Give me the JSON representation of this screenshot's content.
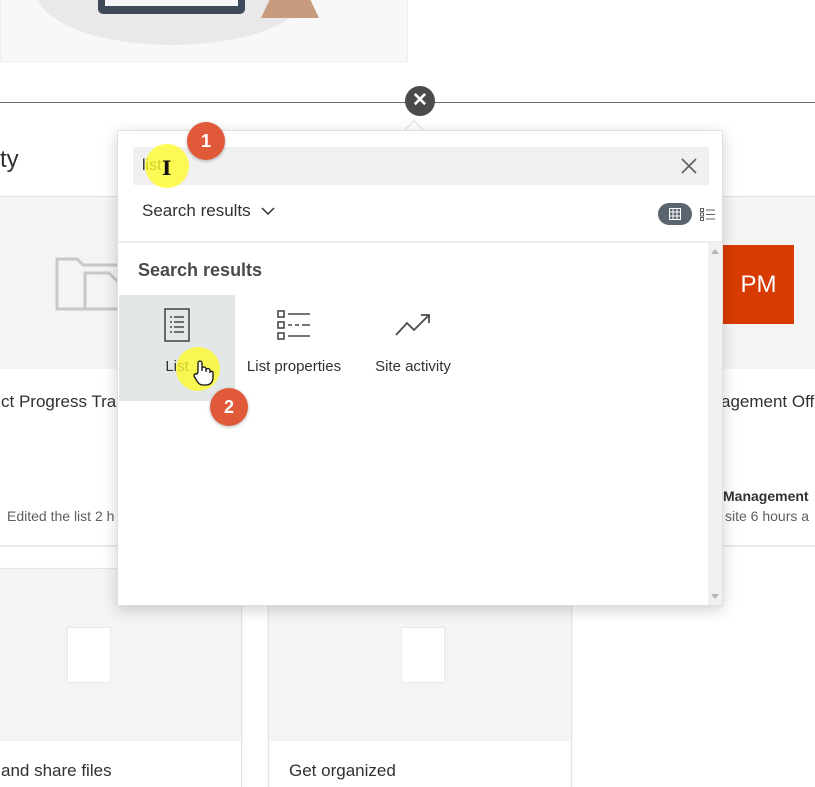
{
  "background": {
    "section_heading": "ty",
    "cards": {
      "progress_tracker": {
        "title": "ct Progress Trac",
        "meta": "Edited the list 2 h"
      },
      "pmo": {
        "tile_initials": "PM",
        "title": "agement Off",
        "bold_line": "Management",
        "meta": "site 6 hours a"
      },
      "share_files": {
        "title": "and share files"
      },
      "get_organized": {
        "title": "Get organized"
      }
    }
  },
  "picker": {
    "search": {
      "value": "list",
      "placeholder": ""
    },
    "scope_label": "Search results",
    "view_modes": {
      "active": "grid",
      "options": [
        "grid",
        "list"
      ]
    },
    "results_heading": "Search results",
    "results": [
      {
        "label": "List",
        "icon": "list-icon",
        "selected": true
      },
      {
        "label": "List properties",
        "icon": "list-properties-icon",
        "selected": false
      },
      {
        "label": "Site activity",
        "icon": "site-activity-icon",
        "selected": false
      }
    ]
  },
  "callouts": {
    "step1": "1",
    "step2": "2",
    "badge_color": "#e05a3a",
    "highlight_color": "#fffa28"
  },
  "colors": {
    "pm_tile": "#d83b01",
    "selected_tile": "#e4e7e8",
    "toggle_active": "#5a6570"
  }
}
